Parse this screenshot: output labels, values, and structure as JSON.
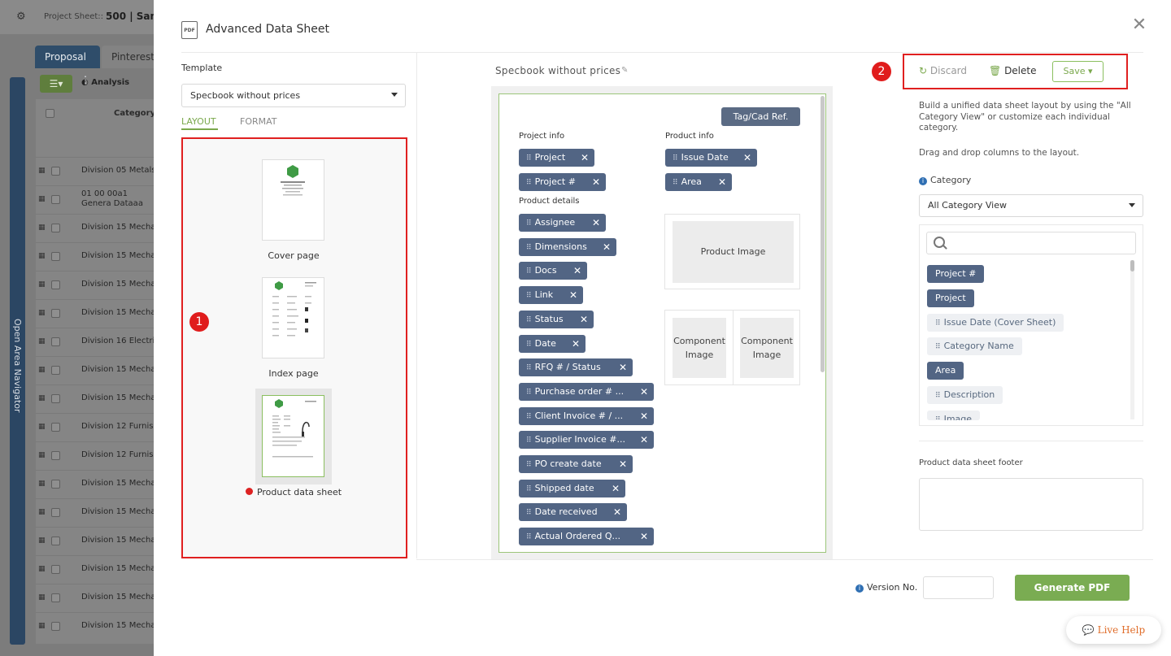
{
  "background": {
    "project_sheet_label": "Project Sheet::",
    "project_name": "500 | Samp",
    "tabs": [
      "Proposal",
      "Pinterest"
    ],
    "analysis_label": "Analysis",
    "rail_label": "Open Area Navigator",
    "column_header": "Category",
    "rows": [
      "Division 05 Metals",
      "01 00 00a1 Genera Dataaa",
      "Division 15 Mechan",
      "Division 15 Mechan",
      "Division 15 Mechan",
      "Division 15 Mechan",
      "Division 16 Electric",
      "Division 15 Mechan",
      "Division 15 Mechan",
      "Division 12 Furnish",
      "Division 12 Furnish",
      "Division 15 Mechan",
      "Division 15 Mechan",
      "Division 15 Mechan",
      "Division 15 Mechan",
      "Division 15 Mechan",
      "Division 15 Mechan"
    ]
  },
  "modal": {
    "title": "Advanced Data Sheet",
    "pdf_icon_text": "PDF",
    "close_icon": "close-icon"
  },
  "template": {
    "label": "Template",
    "selected": "Specbook without prices",
    "tabs": {
      "layout": "LAYOUT",
      "format": "FORMAT"
    },
    "pages": [
      {
        "label": "Cover page"
      },
      {
        "label": "Index page"
      },
      {
        "label": "Product data sheet",
        "error": true
      }
    ],
    "badge_left": "1",
    "badge_right": "2"
  },
  "preview": {
    "title": "Specbook without prices",
    "tag_button": "Tag/Cad Ref.",
    "sections": {
      "project_info": "Project info",
      "product_info": "Product info",
      "product_details": "Product details"
    },
    "project_info_chips": [
      "Project",
      "Project #"
    ],
    "product_info_chips": [
      "Issue Date",
      "Area"
    ],
    "product_details_chips": [
      "Assignee",
      "Dimensions",
      "Docs",
      "Link",
      "Status",
      "Date",
      "RFQ # / Status",
      "Purchase order # ...",
      "Client Invoice # / ...",
      "Supplier Invoice #...",
      "PO create date",
      "Shipped date",
      "Date received",
      "Actual Ordered Q..."
    ],
    "product_image": "Product Image",
    "component_image_1": "Component Image",
    "component_image_2": "Component Image"
  },
  "right": {
    "discard": "Discard",
    "delete": "Delete",
    "save": "Save",
    "desc1": "Build a unified data sheet layout by using the \"All Category View\" or customize each individual category.",
    "desc2": "Drag and drop columns to the layout.",
    "category_label": "Category",
    "category_selected": "All Category View",
    "columns": [
      {
        "label": "Project #",
        "style": "dark"
      },
      {
        "label": "Project",
        "style": "dark"
      },
      {
        "label": "Issue Date (Cover Sheet)",
        "style": "light"
      },
      {
        "label": "Category Name",
        "style": "light"
      },
      {
        "label": "Area",
        "style": "dark"
      },
      {
        "label": "Description",
        "style": "light"
      },
      {
        "label": "Image",
        "style": "light"
      }
    ],
    "footer_label": "Product data sheet footer"
  },
  "bottom": {
    "version_label": "Version No.",
    "version_value": "",
    "generate": "Generate PDF",
    "live_help": "Live Help"
  },
  "colors": {
    "accent_green": "#7aac52",
    "chip_blue": "#526584",
    "highlight_red": "#e02020"
  }
}
